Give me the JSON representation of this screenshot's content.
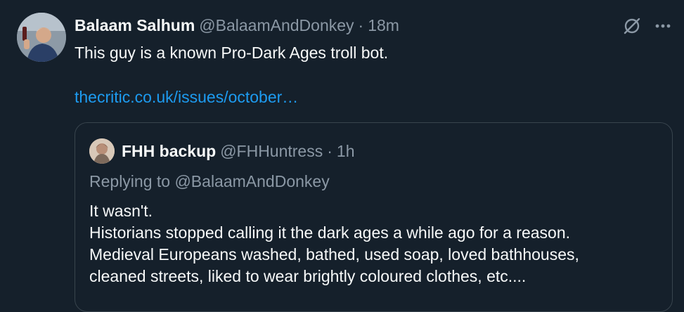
{
  "tweet": {
    "author_name": "Balaam Salhum",
    "author_handle": "@BalaamAndDonkey",
    "separator": "·",
    "time": "18m",
    "text": "This guy is a known Pro-Dark Ages troll bot.",
    "link": "thecritic.co.uk/issues/october…",
    "icons": {
      "grok": "grok-icon",
      "more": "more-icon"
    }
  },
  "quote": {
    "author_name": "FHH backup",
    "author_handle": "@FHHuntress",
    "separator": "·",
    "time": "1h",
    "replying_to": "Replying to @BalaamAndDonkey",
    "lines": [
      "It wasn't.",
      "Historians stopped calling it the dark ages a while ago for a reason.",
      "Medieval Europeans washed, bathed, used soap, loved bathhouses,",
      "cleaned streets, liked to wear brightly coloured clothes, etc...."
    ]
  },
  "colors": {
    "background": "#15202b",
    "text": "#f7f9f9",
    "secondary": "#8b98a5",
    "link": "#1d9bf0",
    "border": "#38444d"
  }
}
